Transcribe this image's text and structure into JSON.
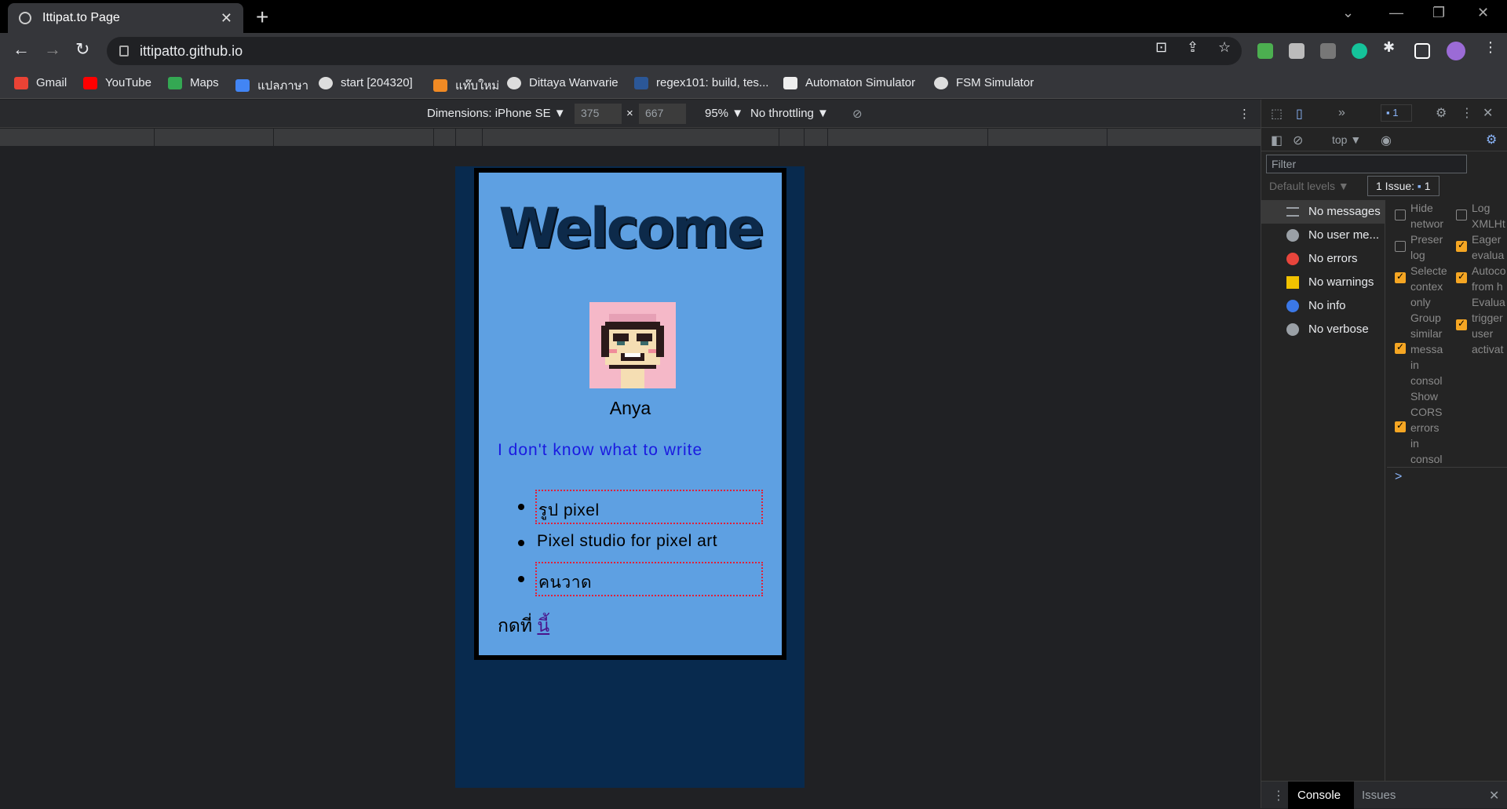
{
  "browser": {
    "tab_title": "Ittipat.to Page",
    "url": "ittipatto.github.io",
    "bookmarks": [
      "Gmail",
      "YouTube",
      "Maps",
      "แปลภาษา",
      "start [204320]",
      "แท๊บใหม่",
      "Dittaya Wanvarie",
      "regex101: build, tes...",
      "Automaton Simulator",
      "FSM Simulator"
    ]
  },
  "device_toolbar": {
    "dimensions": "Dimensions: iPhone SE ▼",
    "width": "375",
    "times": "×",
    "height": "667",
    "zoom": "95% ▼",
    "throttling": "No throttling ▼"
  },
  "page": {
    "welcome": "Welcome",
    "name": "Anya",
    "tagline": "I don't know what to write",
    "list": [
      "รูป pixel",
      "Pixel studio for pixel art",
      "คนวาด"
    ],
    "click_prefix": "กดที่",
    "click_link": "นี้"
  },
  "devtools": {
    "badge_count": "1",
    "context": "top ▼",
    "filter_placeholder": "Filter",
    "default_levels": "Default levels ▼",
    "issue_label": "1 Issue:",
    "issue_count": "1",
    "sidebar": [
      "No messages",
      "No user me...",
      "No errors",
      "No warnings",
      "No info",
      "No verbose"
    ],
    "settings_left": [
      "Hide",
      "networ",
      "Preser",
      "log",
      "Selecte",
      "contex",
      "only",
      "Group",
      "similar",
      "messa",
      "in",
      "consol",
      "Show",
      "CORS",
      "errors",
      "in",
      "consol"
    ],
    "settings_right": [
      "Log",
      "XMLHt",
      "Eager",
      "evalua",
      "Autoco",
      "from h",
      "Evalua",
      "trigger",
      "user",
      "activat"
    ],
    "prompt": ">",
    "tab_console": "Console",
    "tab_issues": "Issues"
  },
  "colors": {
    "card_bg": "#5ea0e2",
    "device_bg": "#082a4e",
    "tagline": "#1a1ae0",
    "dotted_border": "#e0203a"
  }
}
